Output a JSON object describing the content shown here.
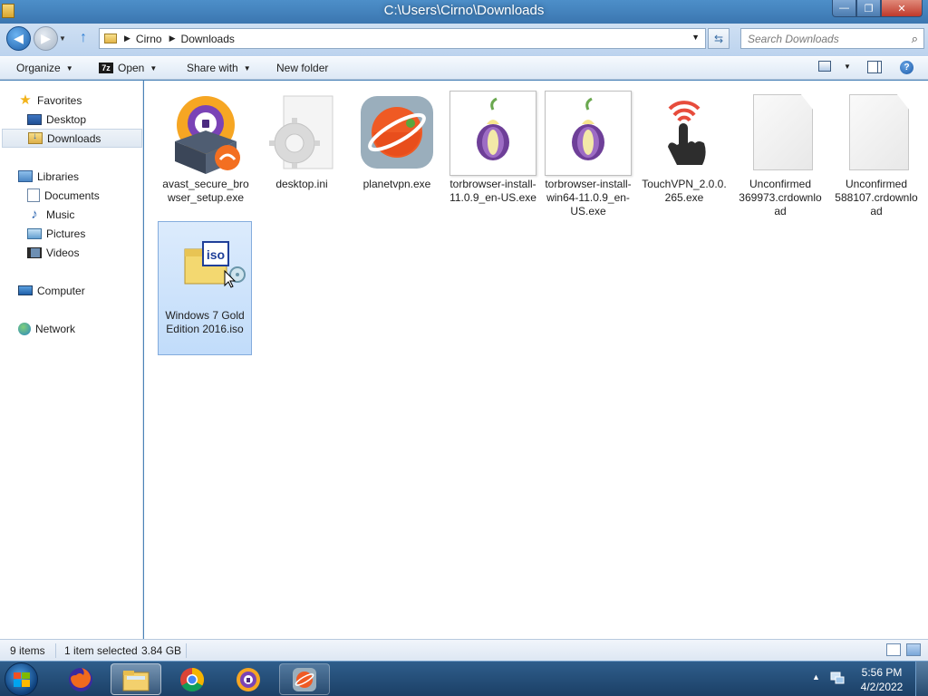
{
  "window": {
    "title": "C:\\Users\\Cirno\\Downloads",
    "minimize_label": "—",
    "maximize_label": "❐",
    "close_label": "✕"
  },
  "address": {
    "crumbs": [
      "Cirno",
      "Downloads"
    ],
    "search_placeholder": "Search Downloads"
  },
  "toolbar": {
    "organize": "Organize",
    "open_badge": "7z",
    "open": "Open",
    "share_with": "Share with",
    "new_folder": "New folder",
    "help": "?"
  },
  "sidebar": {
    "favorites": "Favorites",
    "desktop": "Desktop",
    "downloads": "Downloads",
    "libraries": "Libraries",
    "documents": "Documents",
    "music": "Music",
    "pictures": "Pictures",
    "videos": "Videos",
    "computer": "Computer",
    "network": "Network"
  },
  "files": [
    {
      "name": "avast_secure_browser_setup.exe",
      "icon": "avast-installer-icon"
    },
    {
      "name": "desktop.ini",
      "icon": "settings-file-icon"
    },
    {
      "name": "planetvpn.exe",
      "icon": "planetvpn-icon"
    },
    {
      "name": "torbrowser-install-11.0.9_en-US.exe",
      "icon": "tor-onion-icon"
    },
    {
      "name": "torbrowser-install-win64-11.0.9_en-US.exe",
      "icon": "tor-onion-icon"
    },
    {
      "name": "TouchVPN_2.0.0.265.exe",
      "icon": "touchvpn-icon"
    },
    {
      "name": "Unconfirmed 369973.crdownload",
      "icon": "blank-file-icon"
    },
    {
      "name": "Unconfirmed 588107.crdownload",
      "icon": "blank-file-icon"
    },
    {
      "name": "Windows 7 Gold Edition 2016.iso",
      "icon": "iso-disc-image-icon",
      "badge": "iso",
      "selected": true
    }
  ],
  "status": {
    "item_count": "9 items",
    "selected": "1 item selected",
    "size": "3.84 GB"
  },
  "taskbar": {
    "apps": [
      "firefox-icon",
      "explorer-icon",
      "chrome-icon",
      "avast-browser-icon",
      "planetvpn-icon"
    ],
    "time": "5:56 PM",
    "date": "4/2/2022"
  },
  "colors": {
    "selection": "#c1dcfa",
    "titlebar": "#4d8fc9",
    "taskbar": "#1b3f66"
  }
}
